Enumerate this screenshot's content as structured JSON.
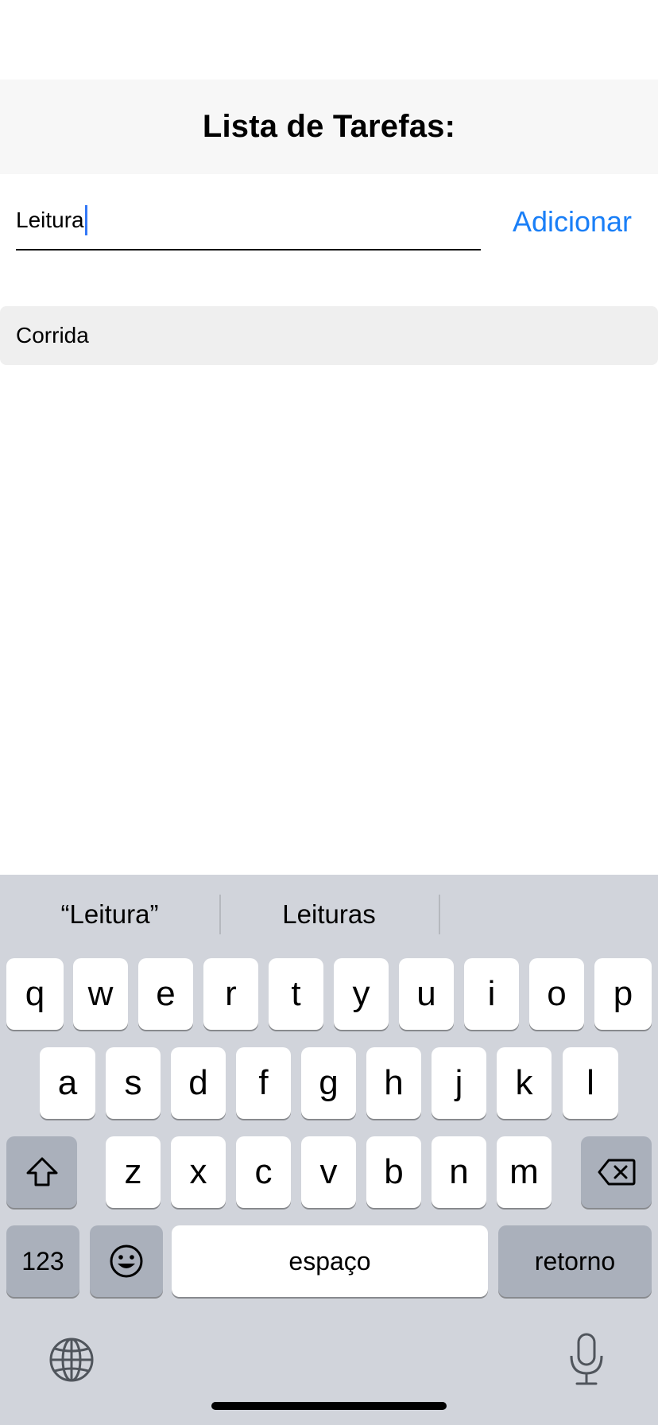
{
  "nav": {
    "title": "Lista de Tarefas:"
  },
  "input": {
    "value": "Leitura"
  },
  "add_button": {
    "label": "Adicionar"
  },
  "tasks": [
    {
      "label": "Corrida"
    }
  ],
  "keyboard": {
    "suggestions": [
      "“Leitura”",
      "Leituras",
      ""
    ],
    "row1": [
      "q",
      "w",
      "e",
      "r",
      "t",
      "y",
      "u",
      "i",
      "o",
      "p"
    ],
    "row2": [
      "a",
      "s",
      "d",
      "f",
      "g",
      "h",
      "j",
      "k",
      "l"
    ],
    "row3": [
      "z",
      "x",
      "c",
      "v",
      "b",
      "n",
      "m"
    ],
    "numbers_label": "123",
    "space_label": "espaço",
    "return_label": "retorno",
    "shift_icon": "shift-icon",
    "delete_icon": "delete-icon",
    "emoji_icon": "emoji-icon",
    "globe_icon": "globe-icon",
    "mic_icon": "microphone-icon"
  },
  "colors": {
    "accent": "#1a7ff7",
    "nav_bg": "#f7f7f7",
    "task_bg": "#efefef",
    "keyboard_bg": "#d1d4db",
    "key_dark": "#aab0bb"
  }
}
